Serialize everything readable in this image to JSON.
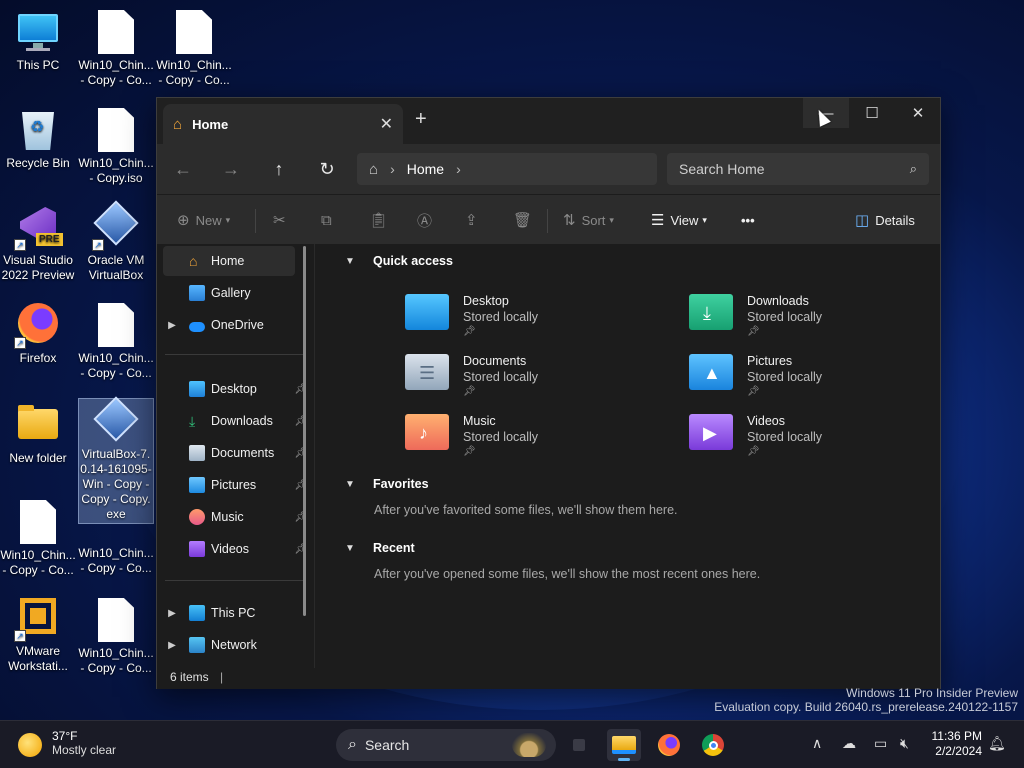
{
  "desktop": {
    "icons": [
      {
        "label": "This PC"
      },
      {
        "label": "Win10_Chin... - Copy - Co..."
      },
      {
        "label": "Win10_Chin... - Copy - Co..."
      },
      {
        "label": "Recycle Bin"
      },
      {
        "label": "Win10_Chin... - Copy.iso"
      },
      {
        "label": "Visual Studio 2022 Preview"
      },
      {
        "label": "Oracle VM VirtualBox"
      },
      {
        "label": "Firefox"
      },
      {
        "label": "Win10_Chin... - Copy - Co..."
      },
      {
        "label": "New folder"
      },
      {
        "label": "VirtualBox-7.0.14-161095-Win - Copy - Copy - Copy.exe"
      },
      {
        "label": "Win10_Chin... - Copy - Co..."
      },
      {
        "label": "Win10_Chin... - Copy - Co..."
      },
      {
        "label": "VMware Workstati..."
      },
      {
        "label": "Win10_Chin... - Copy - Co..."
      }
    ],
    "badge_pre": "PRE"
  },
  "explorer": {
    "tab_title": "Home",
    "address": {
      "crumb": "Home"
    },
    "search_placeholder": "Search Home",
    "commands": {
      "new": "New",
      "sort": "Sort",
      "view": "View",
      "more": "•••",
      "details": "Details"
    },
    "sidebar": {
      "top": [
        "Home",
        "Gallery",
        "OneDrive"
      ],
      "pinned": [
        "Desktop",
        "Downloads",
        "Documents",
        "Pictures",
        "Music",
        "Videos"
      ],
      "bottom": [
        "This PC",
        "Network"
      ]
    },
    "sections": {
      "quick_access": "Quick access",
      "favorites": "Favorites",
      "favorites_empty": "After you've favorited some files, we'll show them here.",
      "recent": "Recent",
      "recent_empty": "After you've opened some files, we'll show the most recent ones here."
    },
    "quick_access": [
      {
        "name": "Desktop",
        "status": "Stored locally"
      },
      {
        "name": "Downloads",
        "status": "Stored locally"
      },
      {
        "name": "Documents",
        "status": "Stored locally"
      },
      {
        "name": "Pictures",
        "status": "Stored locally"
      },
      {
        "name": "Music",
        "status": "Stored locally"
      },
      {
        "name": "Videos",
        "status": "Stored locally"
      }
    ],
    "status": "6 items"
  },
  "watermark": {
    "line1": "Windows 11 Pro Insider Preview",
    "line2": "Evaluation copy. Build 26040.rs_prerelease.240122-1157"
  },
  "taskbar": {
    "weather_temp": "37°F",
    "weather_desc": "Mostly clear",
    "search_label": "Search",
    "time": "11:36 PM",
    "date": "2/2/2024"
  },
  "colors": {
    "accent": "#5fb2f2",
    "window_bg": "#1c1c1c",
    "toolbar_bg": "#2c2c2c"
  }
}
